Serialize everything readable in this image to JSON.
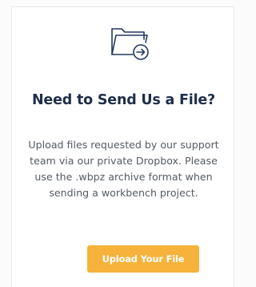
{
  "card": {
    "icon": "folder-send-icon",
    "title": "Need to Send Us a File?",
    "description": "Upload files requested by our support team via our private Dropbox. Please use the .wbpz archive format when sending a workbench project.",
    "button_label": "Upload Your File"
  },
  "colors": {
    "title": "#1e2d4a",
    "body_text": "#555b63",
    "button": "#f6b23a",
    "icon_stroke": "#233a5e"
  }
}
